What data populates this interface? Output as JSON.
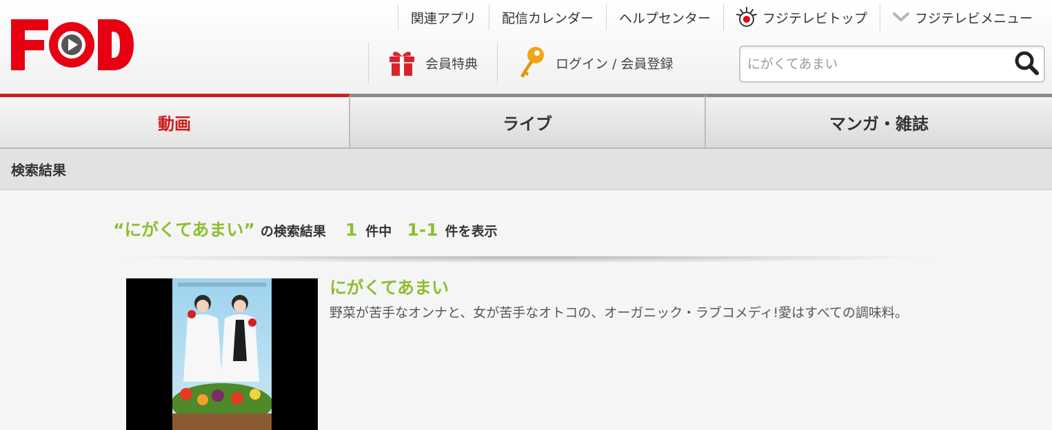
{
  "brand": {
    "logo_text": "FOD",
    "accent": "#e60012",
    "green": "#8cbf2f"
  },
  "topnav": [
    {
      "label": "関連アプリ",
      "icon": ""
    },
    {
      "label": "配信カレンダー",
      "icon": ""
    },
    {
      "label": "ヘルプセンター",
      "icon": ""
    },
    {
      "label": "フジテレビトップ",
      "icon": "fujitv-eye-icon"
    },
    {
      "label": "フジテレビメニュー",
      "icon": "chevron-down-icon"
    }
  ],
  "midnav": {
    "member_benefits": {
      "label": "会員特典",
      "icon": "gift-icon"
    },
    "login": {
      "label": "ログイン / 会員登録",
      "icon": "key-icon"
    }
  },
  "search": {
    "value": "",
    "placeholder": "にがくてあまい",
    "icon": "magnifier-icon"
  },
  "tabs": [
    {
      "label": "動画",
      "active": true
    },
    {
      "label": "ライブ",
      "active": false
    },
    {
      "label": "マンガ・雑誌",
      "active": false
    }
  ],
  "results_bar": {
    "title": "検索結果"
  },
  "summary": {
    "query": "“にがくてあまい”",
    "query_suffix": "の検索結果",
    "total": "1",
    "total_suffix": "件中",
    "range": "1-1",
    "range_suffix": "件を表示"
  },
  "results": [
    {
      "title": "にがくてあまい",
      "description": "野菜が苦手なオンナと、女が苦手なオトコの、オーガニック・ラブコメディ!愛はすべての調味料。",
      "poster_title": "にがくてあまい"
    }
  ]
}
